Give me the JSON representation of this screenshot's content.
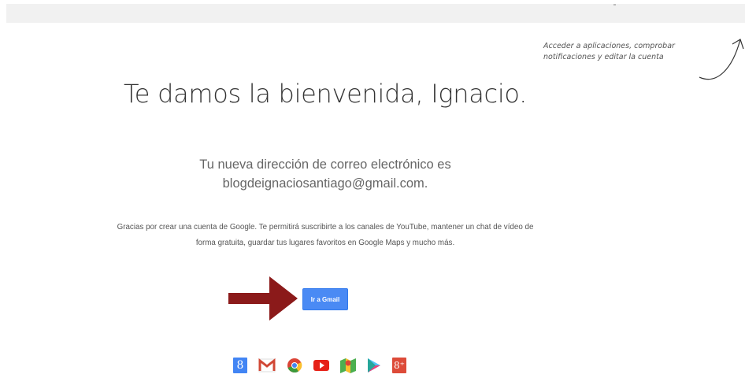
{
  "hint": {
    "text": "Acceder a aplicaciones, comprobar notificaciones y editar la cuenta"
  },
  "main": {
    "title": "Te damos la bienvenida, Ignacio.",
    "subtitle_line1": "Tu nueva dirección de correo electrónico es",
    "subtitle_line2": "blogdeignaciosantiago@gmail.com.",
    "body": "Gracias por crear una cuenta de Google. Te permitirá suscribirte a los canales de YouTube, mantener un chat de vídeo de forma gratuita, guardar tus lugares favoritos en Google Maps y mucho más.",
    "button_label": "Ir a Gmail"
  },
  "apps": [
    {
      "icon": "google-search-icon",
      "glyph": "8"
    },
    {
      "icon": "gmail-icon",
      "glyph": ""
    },
    {
      "icon": "chrome-icon",
      "glyph": ""
    },
    {
      "icon": "youtube-icon",
      "glyph": ""
    },
    {
      "icon": "maps-icon",
      "glyph": ""
    },
    {
      "icon": "play-icon",
      "glyph": ""
    },
    {
      "icon": "google-plus-icon",
      "glyph": "8⁺"
    }
  ],
  "colors": {
    "button": "#4a8af4",
    "arrow": "#8b1a1a",
    "gmail_red": "#d14836",
    "youtube_red": "#e62117",
    "chrome_green": "#3c9a3c",
    "chrome_yellow": "#fbc02d"
  }
}
